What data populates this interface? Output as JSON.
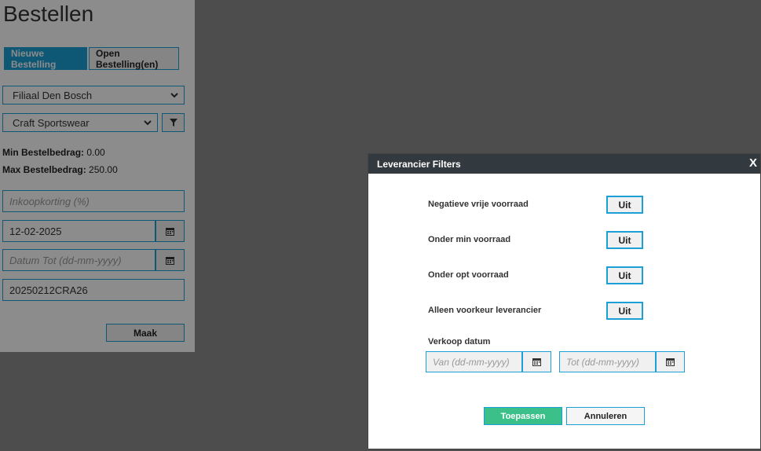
{
  "page": {
    "title": "Bestellen"
  },
  "tabs": {
    "new": "Nieuwe Bestelling",
    "open": "Open Bestelling(en)"
  },
  "form": {
    "branch": "Filiaal Den Bosch",
    "supplier": "Craft Sportswear",
    "min_label": "Min Bestelbedrag:",
    "min_value": "0.00",
    "max_label": "Max Bestelbedrag:",
    "max_value": "250.00",
    "discount_placeholder": "Inkoopkorting (%)",
    "date_from": "12-02-2025",
    "date_to_placeholder": "Datum Tot (dd-mm-yyyy)",
    "reference": "20250212CRA26",
    "make_label": "Maak"
  },
  "modal": {
    "title": "Leverancier Filters",
    "close": "X",
    "options": [
      {
        "label": "Negatieve vrije voorraad",
        "state": "Uit"
      },
      {
        "label": "Onder min voorraad",
        "state": "Uit"
      },
      {
        "label": "Onder opt voorraad",
        "state": "Uit"
      },
      {
        "label": "Alleen voorkeur leverancier",
        "state": "Uit"
      }
    ],
    "sales_date_label": "Verkoop datum",
    "from_placeholder": "Van (dd-mm-yyyy)",
    "to_placeholder": "Tot (dd-mm-yyyy)",
    "apply_label": "Toepassen",
    "cancel_label": "Annuleren"
  },
  "colors": {
    "accent": "#1a9fd6",
    "apply": "#3cc08a",
    "header": "#333a3f"
  }
}
